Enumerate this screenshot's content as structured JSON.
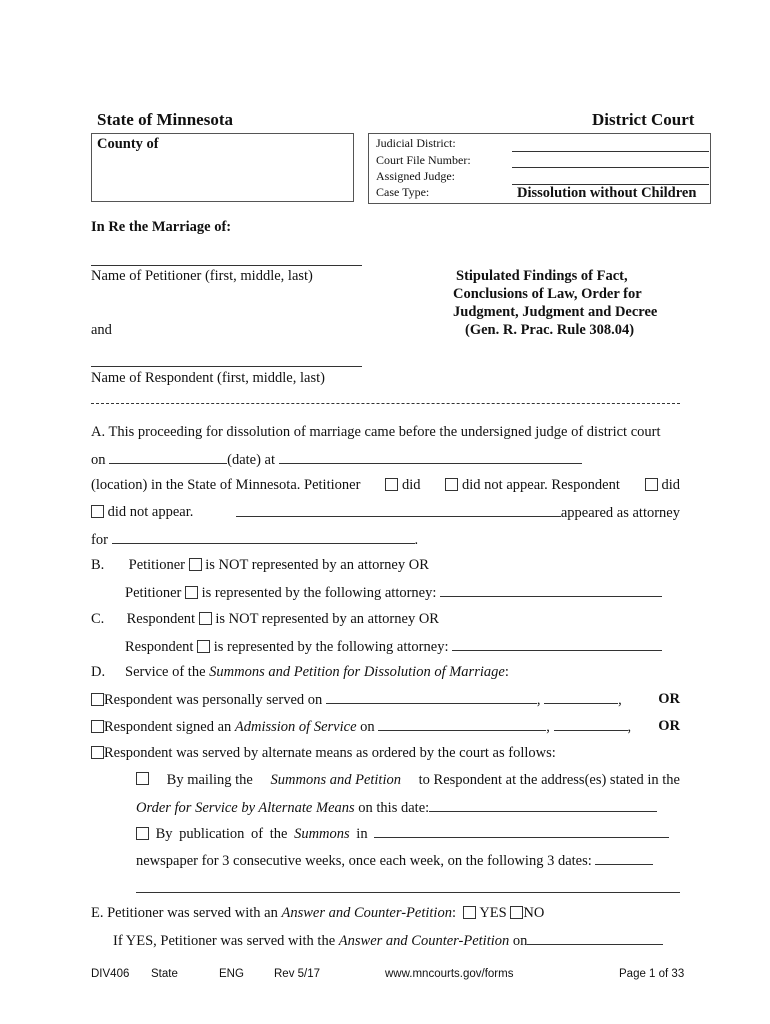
{
  "header": {
    "state": "State of Minnesota",
    "court": "District Court",
    "county_label": "County of",
    "fields": {
      "judicial_district": "Judicial District:",
      "court_file_number": "Court File Number:",
      "assigned_judge": "Assigned Judge:",
      "case_type": "Case Type:",
      "case_type_value": "Dissolution without Children"
    }
  },
  "caption": {
    "in_re": "In Re the Marriage of:",
    "petitioner_label": "Name of Petitioner (first, middle, last)",
    "and": "and",
    "respondent_label": "Name of Respondent (first, middle, last)",
    "title_lines": [
      "Stipulated Findings of Fact,",
      "Conclusions of Law, Order for",
      "Judgment, Judgment and Decree",
      "(Gen. R. Prac.  Rule 308.04)"
    ]
  },
  "section_a": {
    "line1": "A.  This proceeding for dissolution of marriage came before the undersigned judge of district court",
    "on": "on",
    "date_at": "(date)  at",
    "location_text": "(location) in the State of Minnesota.   Petitioner",
    "did": "did",
    "did_not_appear": "did not appear.  Respondent",
    "did2": "did",
    "did_not_appear2": "did not appear.",
    "appeared_as_attorney": "appeared   as   attorney",
    "for": "for",
    "period": "."
  },
  "section_b": {
    "letter": "B.",
    "line1_a": "Petitioner",
    "line1_b": "is NOT represented by an attorney  OR",
    "line2_a": "Petitioner",
    "line2_b": "is represented by the following attorney:"
  },
  "section_c": {
    "letter": "C.",
    "line1_a": "Respondent",
    "line1_b": "is NOT represented by an attorney  OR",
    "line2_a": "Respondent",
    "line2_b": "is represented by the following attorney:"
  },
  "section_d": {
    "letter": "D.",
    "service_prefix": "Service of the ",
    "service_italic": "Summons and Petition for Dissolution of Marriage",
    "service_suffix": ":",
    "personal": "Respondent was personally served on",
    "admission_prefix": "Respondent signed an ",
    "admission_italic": "Admission of Service",
    "admission_suffix": " on",
    "or": "OR",
    "comma": ",",
    "alternate": "Respondent was served by alternate means as ordered by the court as follows:",
    "mailing_prefix": "By mailing the ",
    "mailing_italic": "Summons and Petition",
    "mailing_suffix": " to Respondent at the address(es) stated in the",
    "order_italic": "Order for Service by Alternate Means",
    "order_suffix": " on this date:",
    "publication_prefix": "By publication of the ",
    "publication_italic": "Summons",
    "publication_suffix": " in",
    "newspaper": "newspaper for 3 consecutive weeks, once each week, on the following 3 dates:"
  },
  "section_e": {
    "prefix": "E.  Petitioner was served with an ",
    "italic": "Answer and Counter-Petition",
    "suffix": ":",
    "yes": "YES",
    "no": "NO",
    "if_yes_prefix": "If YES, Petitioner was served with the ",
    "if_yes_italic": "Answer and Counter-Petition",
    "if_yes_suffix": " on"
  },
  "footer": {
    "form_id": "DIV406",
    "jurisdiction": "State",
    "language": "ENG",
    "revision": "Rev 5/17",
    "url": "www.mncourts.gov/forms",
    "page": "Page 1 of 33"
  }
}
